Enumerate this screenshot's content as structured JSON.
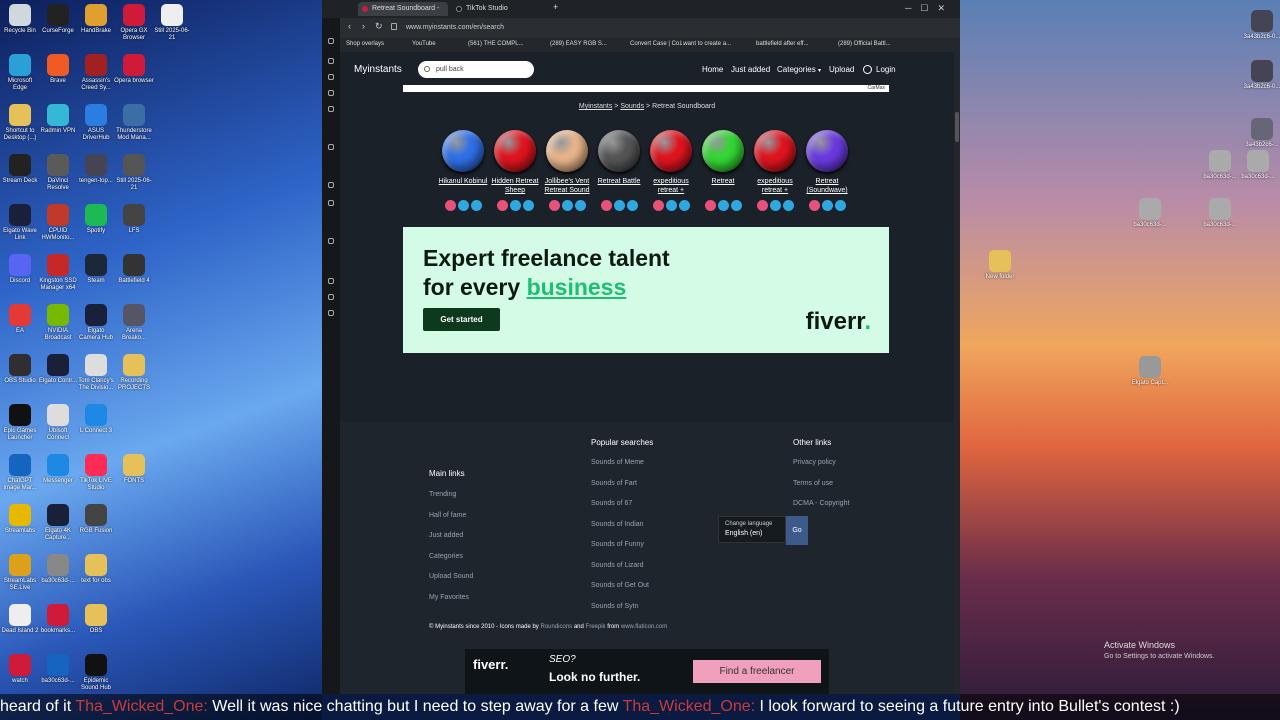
{
  "desktop_left": [
    {
      "label": "Recycle Bin",
      "c": "#cfd8dc"
    },
    {
      "label": "CurseForge",
      "c": "#222"
    },
    {
      "label": "HandBrake",
      "c": "#e0a030"
    },
    {
      "label": "Opera GX Browser",
      "c": "#d01a3a"
    },
    {
      "label": "Still 2025-06-21",
      "c": "#eee"
    },
    {
      "label": "Microsoft Edge",
      "c": "#2a9fd8"
    },
    {
      "label": "Brave",
      "c": "#f05a24"
    },
    {
      "label": "Assassin's Creed Sy...",
      "c": "#a12020"
    },
    {
      "label": "Opera browser",
      "c": "#d01a3a"
    },
    {
      "label": "",
      "c": "transparent"
    },
    {
      "label": "Shortcut to Desktop (...)",
      "c": "#e6c15a"
    },
    {
      "label": "Radmin VPN",
      "c": "#35b7d6"
    },
    {
      "label": "ASUS DriverHub",
      "c": "#2a7de1"
    },
    {
      "label": "Thunderstore Mod Mana...",
      "c": "#3a6ea5"
    },
    {
      "label": "",
      "c": "transparent"
    },
    {
      "label": "Stream Deck",
      "c": "#222"
    },
    {
      "label": "DaVinci Resolve",
      "c": "#5a5a5a"
    },
    {
      "label": "tengen-top...",
      "c": "#445"
    },
    {
      "label": "Still 2025-06-21",
      "c": "#555"
    },
    {
      "label": "",
      "c": "transparent"
    },
    {
      "label": "Elgato Wave Link",
      "c": "#1a1f3a"
    },
    {
      "label": "CPUID HWMonito...",
      "c": "#c0392b"
    },
    {
      "label": "Spotify",
      "c": "#1db954"
    },
    {
      "label": "LFS",
      "c": "#444"
    },
    {
      "label": "",
      "c": "transparent"
    },
    {
      "label": "Discord",
      "c": "#5865f2"
    },
    {
      "label": "Kingston SSD Manager x64",
      "c": "#c62828"
    },
    {
      "label": "Steam",
      "c": "#1b2838"
    },
    {
      "label": "Battlefield 4",
      "c": "#333"
    },
    {
      "label": "",
      "c": "transparent"
    },
    {
      "label": "EA",
      "c": "#e53935"
    },
    {
      "label": "NVIDIA Broadcast",
      "c": "#76b900"
    },
    {
      "label": "Elgato Camera Hub",
      "c": "#1a1f3a"
    },
    {
      "label": "Arena Breako...",
      "c": "#556"
    },
    {
      "label": "",
      "c": "transparent"
    },
    {
      "label": "OBS Studio",
      "c": "#302e31"
    },
    {
      "label": "Elgato Contr...",
      "c": "#1a1f3a"
    },
    {
      "label": "Tom Clancy's The Divisio...",
      "c": "#ddd"
    },
    {
      "label": "Recording PROJECTS",
      "c": "#e6c15a"
    },
    {
      "label": "",
      "c": "transparent"
    },
    {
      "label": "Epic Games Launcher",
      "c": "#111"
    },
    {
      "label": "Ubisoft Connect",
      "c": "#ddd"
    },
    {
      "label": "L Connect 3",
      "c": "#1e88e5"
    },
    {
      "label": "",
      "c": "transparent"
    },
    {
      "label": "",
      "c": "transparent"
    },
    {
      "label": "ChatGPT Image Mar...",
      "c": "#1565c0"
    },
    {
      "label": "Messenger",
      "c": "#1e88e5"
    },
    {
      "label": "TikTok LIVE Studio",
      "c": "#fe2c55"
    },
    {
      "label": "FONTS",
      "c": "#e6c15a"
    },
    {
      "label": "",
      "c": "transparent"
    },
    {
      "label": "Streamlabs",
      "c": "#e6b800"
    },
    {
      "label": "Elgato 4K Capture...",
      "c": "#1a1f3a"
    },
    {
      "label": "RGB Fusion",
      "c": "#444"
    },
    {
      "label": "",
      "c": "transparent"
    },
    {
      "label": "",
      "c": "transparent"
    },
    {
      "label": "StreamLabs SE.Live",
      "c": "#dca01a"
    },
    {
      "label": "ba30c63d-...",
      "c": "#888"
    },
    {
      "label": "text for obs",
      "c": "#e6c15a"
    },
    {
      "label": "",
      "c": "transparent"
    },
    {
      "label": "",
      "c": "transparent"
    },
    {
      "label": "Dead Island 2",
      "c": "#eee"
    },
    {
      "label": "bookmarks...",
      "c": "#d01a3a"
    },
    {
      "label": "OBS",
      "c": "#e6c15a"
    },
    {
      "label": "",
      "c": "transparent"
    },
    {
      "label": "",
      "c": "transparent"
    },
    {
      "label": "watch",
      "c": "#d01a3a"
    },
    {
      "label": "ba30c63d-...",
      "c": "#1565c0"
    },
    {
      "label": "Epidemic Sound Hub",
      "c": "#111"
    }
  ],
  "desktop_right": [
    {
      "label": "3a43b2c6-0...",
      "c": "#445"
    },
    {
      "label": "3a43b2c6-0...",
      "c": "#445"
    },
    {
      "label": "3a43b2c6-...",
      "c": "#667"
    },
    {
      "label": "ba30c63d-...",
      "c": "#aaa"
    },
    {
      "label": "ba30c63d-...",
      "c": "#aaa"
    },
    {
      "label": "ba30c63d-...",
      "c": "#aaa"
    },
    {
      "label": "ba30c63d-...",
      "c": "#aaa"
    },
    {
      "label": "ba30c63d-...",
      "c": "#aaa"
    },
    {
      "label": "New folder",
      "c": "#e6c15a"
    },
    {
      "label": "Elgato Capt...",
      "c": "#999"
    }
  ],
  "browser": {
    "tabs": [
      {
        "title": "Retreat Soundboard - Inst...",
        "fav": "#d01a3a"
      },
      {
        "title": "TikTok Studio",
        "fav": "#111"
      }
    ],
    "url": "www.myinstants.com/en/search",
    "bookmarks": [
      "Shop overlays",
      "YouTube",
      "(561) THE COMPL...",
      "(289) EASY RGB S...",
      "Convert Case | Co...",
      "I want to create a...",
      "battlefield after eff...",
      "(289) Official Battl..."
    ]
  },
  "site": {
    "logo": "Myinstants",
    "search_placeholder": "pull back",
    "nav": [
      "Home",
      "Just added",
      "Categories",
      "Upload",
      "Login"
    ],
    "ad_top_label": "CarMax",
    "breadcrumb": {
      "home": "Myinstants",
      "sounds": "Sounds",
      "current": "Retreat Soundboard",
      "sep": ">"
    },
    "sounds": [
      {
        "name": "Hikanul Kobinul",
        "color": "#2f6fe8"
      },
      {
        "name": "Hidden Retreat Sheep",
        "color": "#e0141e"
      },
      {
        "name": "Jollibee's Vent Retreat Sound",
        "color": "#e8b48a"
      },
      {
        "name": "Retreat Battle",
        "color": "#555555"
      },
      {
        "name": "expeditious retreat +",
        "color": "#e0141e"
      },
      {
        "name": "Retreat",
        "color": "#33d633"
      },
      {
        "name": "expeditious retreat +",
        "color": "#e0141e"
      },
      {
        "name": "Retreat (Soundwave)",
        "color": "#6a3ae0"
      }
    ],
    "ad_big": {
      "line1": "Expert freelance talent",
      "line2_pre": "for every ",
      "line2_link": "business",
      "cta": "Get started",
      "brand": "fiverr",
      "brand_dot": "."
    },
    "footer": {
      "main_links_title": "Main links",
      "main_links": [
        "Trending",
        "Hall of fame",
        "Just added",
        "Categories",
        "Upload Sound",
        "My Favorites"
      ],
      "popular_title": "Popular searches",
      "popular": [
        "Sounds of Meme",
        "Sounds of Fart",
        "Sounds of 67",
        "Sounds of Indian",
        "Sounds of Funny",
        "Sounds of Lizard",
        "Sounds of Get Out",
        "Sounds of Sytn"
      ],
      "other_title": "Other links",
      "other": [
        "Privacy policy",
        "Terms of use",
        "DCMA - Copyright"
      ],
      "lang_label": "Change language",
      "lang_value": "English (en)",
      "go": "Go",
      "copyright": "© Myinstants since 2010 - Icons made by",
      "roundicons": "Roundicons",
      "and": "and",
      "freepik": "Freepik",
      "from": "from",
      "flaticon": "www.flaticon.com"
    },
    "ad_bottom": {
      "brand": "fiverr.",
      "seo": "SEO?",
      "look": "Look no further.",
      "cta": "Find a freelancer"
    }
  },
  "caption": {
    "pre": "heard of it ",
    "user1": "Tha_Wicked_One:",
    "msg1": " Well it was nice chatting but I need to step away for a few ",
    "user2": "Tha_Wicked_One:",
    "msg2": " I look forward to seeing a future entry into Bullet's contest :)"
  },
  "windows_activation": {
    "line1": "Activate Windows",
    "line2": "Go to Settings to activate Windows."
  }
}
